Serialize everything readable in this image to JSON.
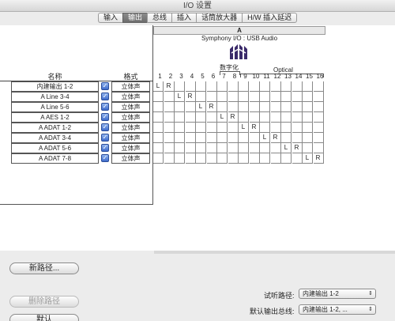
{
  "window": {
    "title": "I/O 设置"
  },
  "tabs": [
    {
      "label": "输入",
      "active": false
    },
    {
      "label": "输出",
      "active": true
    },
    {
      "label": "总线",
      "active": false
    },
    {
      "label": "插入",
      "active": false
    },
    {
      "label": "话筒放大器",
      "active": false
    },
    {
      "label": "H/W 插入延迟",
      "active": false
    }
  ],
  "table": {
    "name_header": "名称",
    "format_header": "格式",
    "rows": [
      {
        "name": "内建输出 1-2",
        "format": "立体声",
        "checked": true
      },
      {
        "name": "A Line 3-4",
        "format": "立体声",
        "checked": true
      },
      {
        "name": "A Line 5-6",
        "format": "立体声",
        "checked": true
      },
      {
        "name": "A AES 1-2",
        "format": "立体声",
        "checked": true
      },
      {
        "name": "A ADAT 1-2",
        "format": "立体声",
        "checked": true
      },
      {
        "name": "A ADAT 3-4",
        "format": "立体声",
        "checked": true
      },
      {
        "name": "A ADAT 5-6",
        "format": "立体声",
        "checked": true
      },
      {
        "name": "A ADAT 7-8",
        "format": "立体声",
        "checked": true
      }
    ]
  },
  "grid": {
    "bus": "A",
    "device": "Symphony I/O : USB Audio",
    "group_digital": "数字化",
    "group_optical": "Optical",
    "channels": [
      "1",
      "2",
      "3",
      "4",
      "5",
      "6",
      "7",
      "8",
      "9",
      "10",
      "11",
      "12",
      "13",
      "14",
      "15",
      "16"
    ],
    "left_mark": "L",
    "right_mark": "R"
  },
  "buttons": {
    "new_path": "新路径...",
    "delete_path": "删除路径",
    "default": "默认"
  },
  "audition": {
    "label": "试听路径:",
    "value": "内建输出 1-2"
  },
  "default_output": {
    "label": "默认输出总线:",
    "value": "内建输出 1-2, ..."
  },
  "icons": {
    "logo": "apogee-logo-icon",
    "checkbox": "checkmark-icon",
    "dropdown": "updown-arrows-icon"
  }
}
